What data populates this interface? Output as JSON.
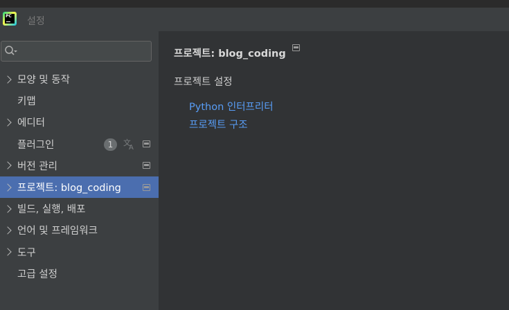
{
  "window": {
    "title": "설정",
    "app_logo_text": "PC"
  },
  "search": {
    "placeholder": ""
  },
  "sidebar": {
    "items": [
      {
        "label": "모양 및 동작",
        "expandable": true
      },
      {
        "label": "키맵",
        "expandable": false
      },
      {
        "label": "에디터",
        "expandable": true
      },
      {
        "label": "플러그인",
        "expandable": false,
        "badge": "1"
      },
      {
        "label": "버전 관리",
        "expandable": true
      },
      {
        "label": "프로젝트: blog_coding",
        "expandable": true,
        "selected": true
      },
      {
        "label": "빌드, 실행, 배포",
        "expandable": true
      },
      {
        "label": "언어 및 프레임워크",
        "expandable": true
      },
      {
        "label": "도구",
        "expandable": true
      },
      {
        "label": "고급 설정",
        "expandable": false
      }
    ]
  },
  "main": {
    "title": "프로젝트: blog_coding",
    "section": "프로젝트 설정",
    "links": [
      "Python 인터프리터",
      "프로젝트 구조"
    ]
  },
  "colors": {
    "selected_bg": "#4b6eaf",
    "link": "#589df6",
    "panel_bg": "#3c3f41",
    "content_bg": "#313335"
  },
  "icons": [
    "app-logo",
    "search-icon",
    "chevron-right-icon",
    "translate-icon",
    "project-scope-icon"
  ]
}
